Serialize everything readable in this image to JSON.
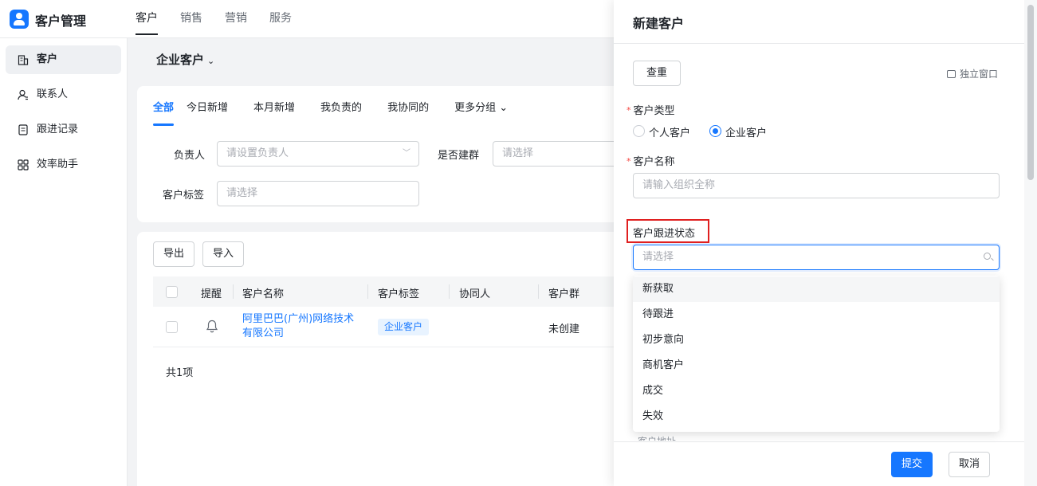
{
  "app": {
    "title": "客户管理"
  },
  "top_nav": [
    {
      "label": "客户",
      "active": true
    },
    {
      "label": "销售",
      "active": false
    },
    {
      "label": "营销",
      "active": false
    },
    {
      "label": "服务",
      "active": false
    }
  ],
  "sidebar": {
    "items": [
      {
        "label": "客户",
        "icon": "building-icon",
        "active": true
      },
      {
        "label": "联系人",
        "icon": "contact-icon",
        "active": false
      },
      {
        "label": "跟进记录",
        "icon": "record-icon",
        "active": false
      },
      {
        "label": "效率助手",
        "icon": "grid-icon",
        "active": false
      }
    ]
  },
  "main": {
    "title": "企业客户",
    "title_chevron": "⌄",
    "tabs": [
      {
        "label": "全部",
        "active": true
      },
      {
        "label": "今日新增"
      },
      {
        "label": "本月新增"
      },
      {
        "label": "我负责的"
      },
      {
        "label": "我协同的"
      },
      {
        "label": "更多分组 ⌄"
      }
    ],
    "filters": {
      "owner_label": "负责人",
      "owner_placeholder": "请设置负责人",
      "group_label": "是否建群",
      "group_placeholder": "请选择",
      "tag_label": "客户标签",
      "tag_placeholder": "请选择"
    },
    "actions": {
      "export": "导出",
      "import": "导入"
    },
    "table": {
      "headers": [
        "提醒",
        "客户名称",
        "客户标签",
        "协同人",
        "客户群"
      ],
      "rows": [
        {
          "name": "阿里巴巴(广州)网络技术有限公司",
          "tag": "企业客户",
          "collaborator": "",
          "group": "未创建"
        }
      ]
    },
    "total": "共1项"
  },
  "drawer": {
    "title": "新建客户",
    "reset": "查重",
    "popout": "独立窗口",
    "customer_type_label": "客户类型",
    "customer_type_options": [
      {
        "label": "个人客户",
        "selected": false
      },
      {
        "label": "企业客户",
        "selected": true
      }
    ],
    "customer_name_label": "客户名称",
    "customer_name_placeholder": "请输入组织全称",
    "follow_status_label": "客户跟进状态",
    "follow_status_placeholder": "请选择",
    "follow_status_options": [
      "新获取",
      "待跟进",
      "初步意向",
      "商机客户",
      "成交",
      "失效"
    ],
    "partial_text": "客户地址",
    "submit": "提交",
    "cancel": "取消"
  },
  "colors": {
    "primary": "#1677ff",
    "highlight_box": "#e02020",
    "required_star": "#f54a45"
  }
}
